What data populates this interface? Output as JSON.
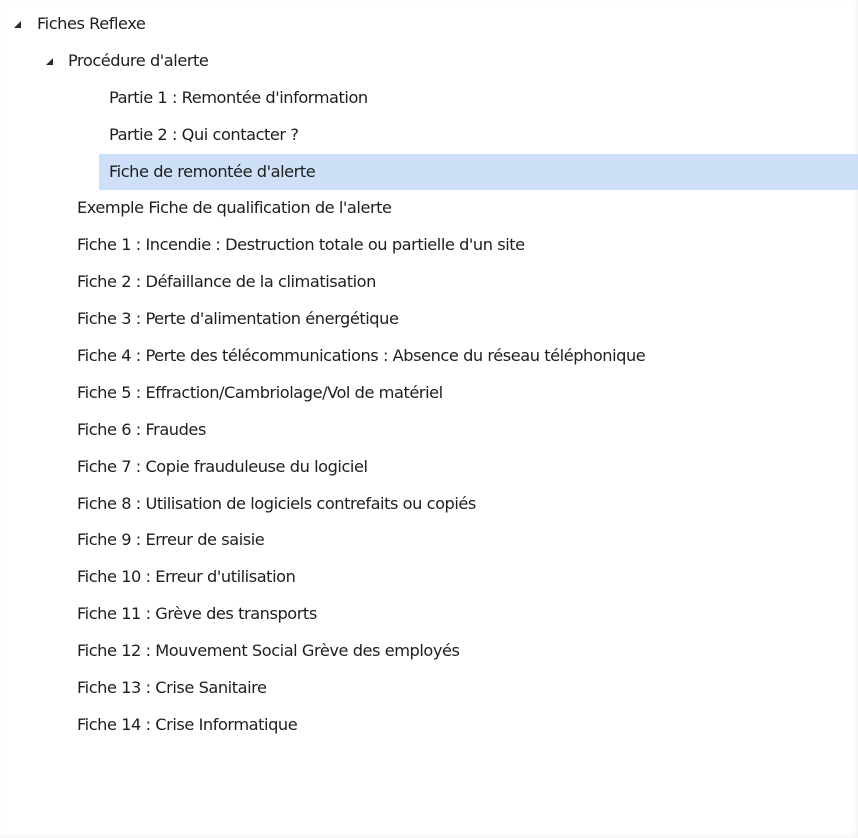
{
  "tree": {
    "root": {
      "label": "Fiches Reflexe",
      "expanded": true,
      "icon": "expanded-triangle-icon"
    },
    "procedure": {
      "label": "Procédure d'alerte",
      "expanded": true,
      "icon": "expanded-triangle-icon",
      "children": [
        "Partie 1 : Remontée d'information",
        "Partie 2 : Qui contacter ?",
        "Fiche de remontée d'alerte"
      ],
      "selected": "Fiche de remontée d'alerte"
    },
    "items": [
      "Exemple Fiche de qualification de l'alerte",
      "Fiche 1 : Incendie : Destruction totale ou partielle d'un site",
      "Fiche 2 : Défaillance de la climatisation",
      "Fiche 3 : Perte d'alimentation énergétique",
      "Fiche 4 : Perte des télécommunications : Absence du réseau téléphonique",
      "Fiche 5 : Effraction/Cambriolage/Vol de matériel",
      "Fiche 6 : Fraudes",
      "Fiche 7 : Copie frauduleuse du logiciel",
      "Fiche 8 : Utilisation de logiciels contrefaits ou copiés",
      "Fiche 9 : Erreur de saisie",
      "Fiche 10 : Erreur d'utilisation",
      "Fiche 11 : Grève des transports",
      "Fiche 12 : Mouvement Social Grève des employés",
      "Fiche 13 : Crise Sanitaire",
      "Fiche 14 : Crise Informatique"
    ]
  },
  "colors": {
    "selection": "#cde0f7",
    "text": "#1e1e1e",
    "toggle": "#2b2b2b"
  }
}
